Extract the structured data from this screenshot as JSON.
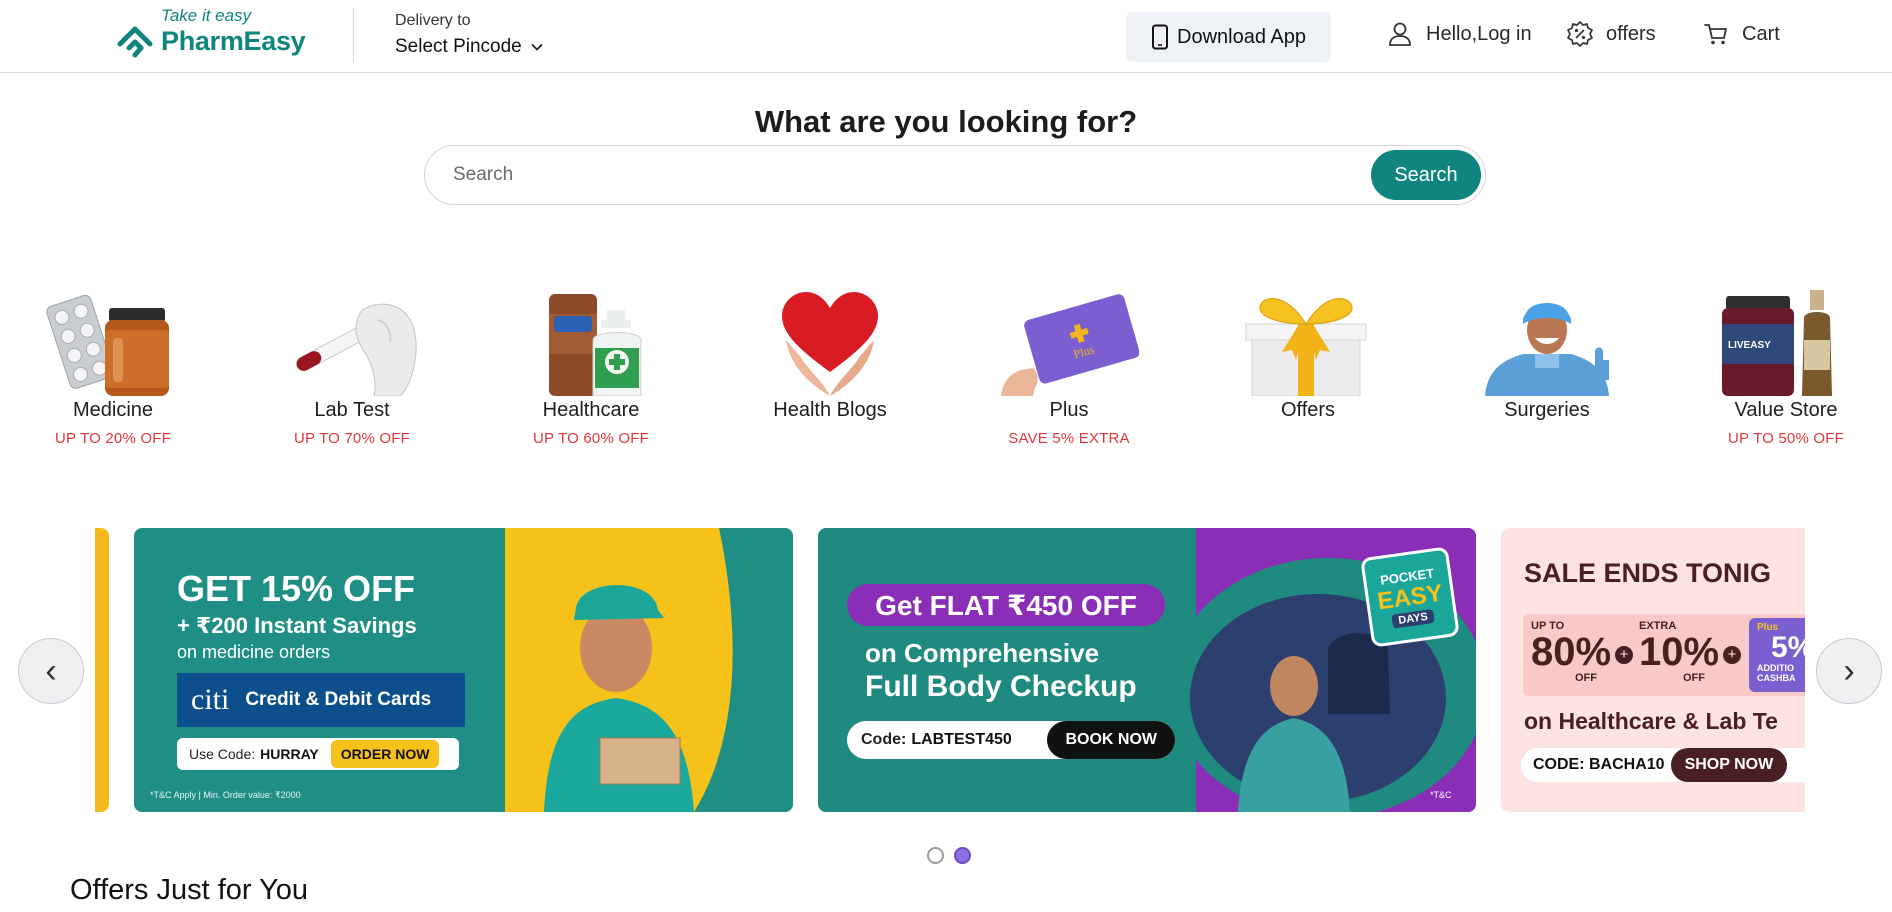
{
  "header": {
    "tagline": "Take it easy",
    "brand": "PharmEasy",
    "delivery_label": "Delivery to",
    "delivery_value": "Select Pincode",
    "download_app": "Download App",
    "login": "Hello,Log in",
    "offers": "offers",
    "cart": "Cart"
  },
  "search": {
    "title": "What are you looking for?",
    "placeholder": "Search",
    "button": "Search"
  },
  "categories": [
    {
      "name": "Medicine",
      "offer": "UP TO 20% OFF"
    },
    {
      "name": "Lab Test",
      "offer": "UP TO 70% OFF"
    },
    {
      "name": "Healthcare",
      "offer": "UP TO 60% OFF"
    },
    {
      "name": "Health Blogs",
      "offer": ""
    },
    {
      "name": "Plus",
      "offer": "SAVE 5% EXTRA",
      "card_text": "Plus"
    },
    {
      "name": "Offers",
      "offer": ""
    },
    {
      "name": "Surgeries",
      "offer": ""
    },
    {
      "name": "Value Store",
      "offer": "UP TO 50% OFF",
      "jar_text": "LIVEASY"
    }
  ],
  "banners": [
    {
      "headline": "GET 15% OFF",
      "sub1": "+ ₹200 Instant Savings",
      "sub2": "on medicine orders",
      "card_brand": "citi",
      "card_text": "Credit & Debit Cards",
      "code_label": "Use Code:",
      "code": "HURRAY",
      "cta": "ORDER NOW",
      "fine": "*T&C Apply | Min. Order value: ₹2000",
      "colors": {
        "bg": "#1f8f86",
        "accent": "#f6c21a"
      }
    },
    {
      "headline": "Get FLAT ₹450 OFF",
      "sub1": "on Comprehensive",
      "sub2": "Full Body Checkup",
      "code_label": "Code:",
      "code": "LABTEST450",
      "cta": "BOOK NOW",
      "badge1": "POCKET",
      "badge2": "EASY",
      "badge3": "DAYS",
      "fine": "*T&C",
      "colors": {
        "bg": "#1f8a80",
        "accent": "#8a2eb8"
      }
    },
    {
      "headline": "SALE ENDS TONIG",
      "p1_small": "UP TO",
      "p1_big": "80%",
      "p1_suffix": "OFF",
      "p2_small": "EXTRA",
      "p2_big": "10%",
      "p2_suffix": "OFF",
      "p3_badge": "Plus",
      "p3_big": "5%",
      "p3_small": "ADDITIO",
      "p3_small2": "CASHBA",
      "sub": "on Healthcare & Lab Te",
      "code": "CODE: BACHA10",
      "cta": "SHOP NOW",
      "colors": {
        "bg": "#fde4e2",
        "accent": "#4a1f22"
      }
    }
  ],
  "carousel": {
    "prev": "‹",
    "next": "›",
    "dot_count": 2,
    "active_dot": 2
  },
  "section": {
    "offers_title": "Offers Just for You"
  },
  "colors": {
    "brand": "#10847e",
    "offer_red": "#e2363a",
    "active_dot": "#8c6fe0"
  }
}
